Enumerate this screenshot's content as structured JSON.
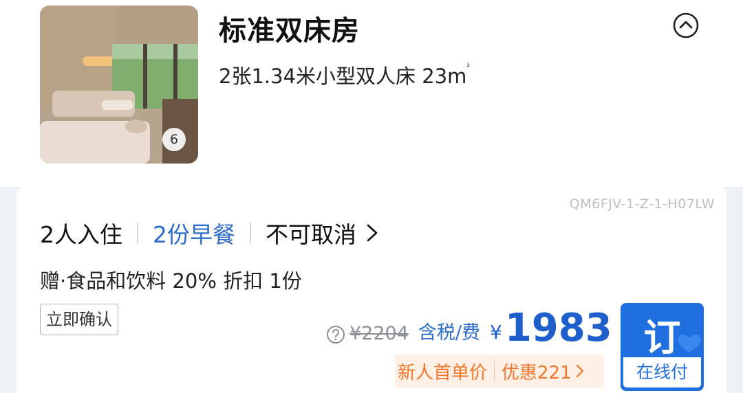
{
  "room": {
    "name": "标准双床房",
    "beds": "2张1.34米小型双人床",
    "area": "23m",
    "area_sup": "²",
    "photo_count": "6"
  },
  "rate": {
    "code": "QM6FJV-1-Z-1-H07LW",
    "occupancy": "2人入住",
    "meal": "2份早餐",
    "cancel": "不可取消",
    "gift": "赠·食品和饮料 20% 折扣 1份",
    "confirm_tag": "立即确认",
    "original_price": "¥2204",
    "tax_label": "含税/费",
    "currency": "¥",
    "price": "1983",
    "promo_new": "新人首单价",
    "promo_discount": "优惠221"
  },
  "book_button": {
    "label": "订",
    "pay_label": "在线付"
  },
  "icons": [
    "photo-icon",
    "chevron-up-circle-icon",
    "chevron-right-icon",
    "question-circle-icon"
  ],
  "colors": {
    "accent": "#1f6fe0",
    "price": "#1f5fcc",
    "link": "#2d6cc8",
    "promo": "#f2762b",
    "promo_bg": "#fff0e6"
  }
}
